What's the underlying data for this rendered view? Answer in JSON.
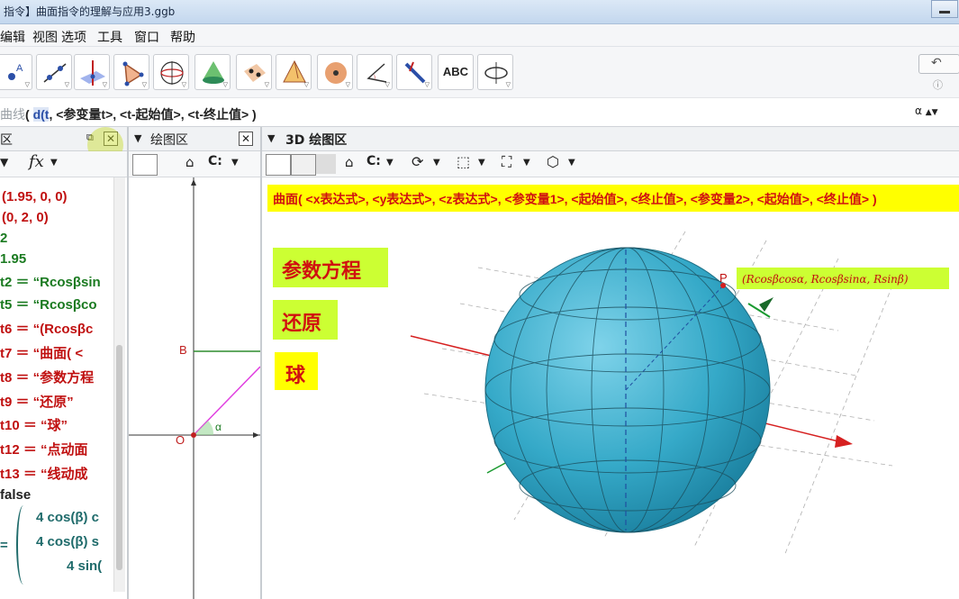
{
  "window": {
    "title": "指令】曲面指令的理解与应用3.ggb"
  },
  "menu": {
    "items": [
      "编辑",
      "视图",
      "选项",
      "工具",
      "窗口",
      "帮助"
    ]
  },
  "toolbar": {
    "tools": [
      "point-tool-icon",
      "line-tool-icon",
      "perpendicular-tool-icon",
      "polygon-tool-icon",
      "circle-tool-icon",
      "cone-tool-icon",
      "intersect-tool-icon",
      "pyramid-tool-icon",
      "sphere-tool-icon",
      "angle-tool-icon",
      "reflect-tool-icon",
      "text-tool",
      "rotate-view-tool-icon"
    ],
    "text_tool_label": "ABC",
    "undo_icon": "undo-icon",
    "help_icon": "help-icon"
  },
  "input_bar": {
    "prefix": "曲线",
    "command_open": "( ",
    "arg1": "d(t",
    "arg_rest": ", <参变量t>, <t-起始值>, <t-终止值> )",
    "alpha_button": "α"
  },
  "algebra_panel": {
    "header": "区",
    "fx_label": "fx",
    "rows": [
      {
        "text": "(1.95, 0, 0)",
        "color": "red"
      },
      {
        "text": "(0, 2, 0)",
        "color": "red"
      },
      {
        "text": "2",
        "color": "green"
      },
      {
        "text": "1.95",
        "color": "green"
      },
      {
        "text": "t2 ＝ “Rcosβsin",
        "color": "green"
      },
      {
        "text": "t5 ＝ “Rcosβco",
        "color": "green"
      },
      {
        "text": "t6 ＝ “(Rcosβc",
        "color": "red"
      },
      {
        "text": "t7 ＝ “曲面( <",
        "color": "red"
      },
      {
        "text": "t8 ＝ “参数方程",
        "color": "red"
      },
      {
        "text": "t9 ＝ “还原”",
        "color": "red"
      },
      {
        "text": "t10 ＝ “球”",
        "color": "red"
      },
      {
        "text": "t12 ＝ “点动面",
        "color": "red"
      },
      {
        "text": "t13 ＝ “线动成",
        "color": "red"
      },
      {
        "text": "false",
        "color": "black"
      }
    ],
    "matrix": {
      "eq": "=",
      "line1": "4 cos(β) c",
      "line2": "4 cos(β) s",
      "line3": "4 sin("
    }
  },
  "graphics_panel": {
    "header": "绘图区",
    "labels": {
      "B": "B",
      "O": "O",
      "alpha": "α"
    }
  },
  "view3d": {
    "header": "3D 绘图区",
    "command_hint": "曲面( <x表达式>, <y表达式>, <z表达式>, <参变量1>, <起始值>, <终止值>, <参变量2>, <起始值>, <终止值> )",
    "buttons": [
      "参数方程",
      "还原",
      "球"
    ],
    "point_label": "P",
    "point_coords": "(Rcosβcosα, Rcosβsinα, Rsinβ)",
    "colors": {
      "sphere": "#35a9c8",
      "x_axis": "#d62020",
      "y_axis": "#1a9a30",
      "z_axis": "#1f4fa0"
    }
  }
}
